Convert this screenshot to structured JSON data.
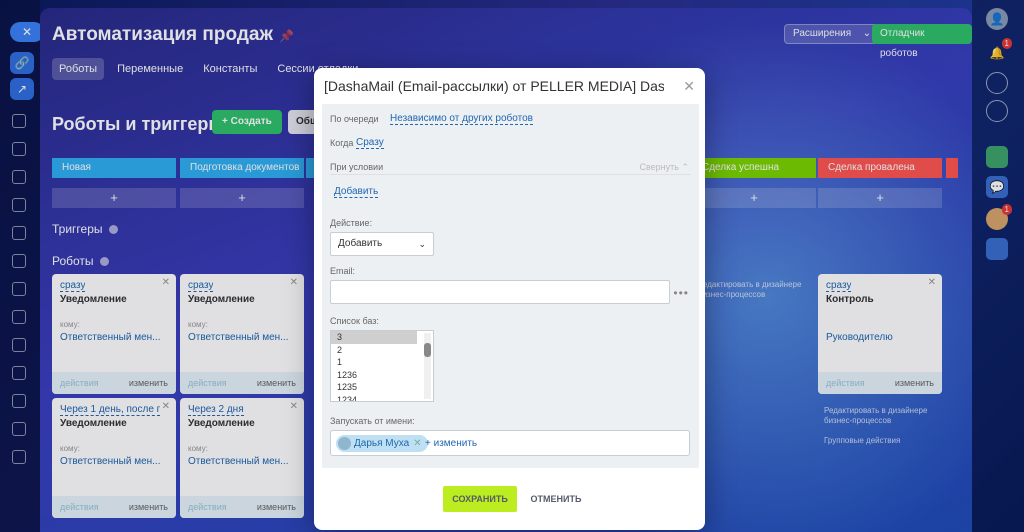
{
  "app": {
    "title": "Автоматизация продаж",
    "extensions_label": "Расширения",
    "debug_label": "Отладчик роботов",
    "tabs": [
      {
        "label": "Роботы",
        "active": true
      },
      {
        "label": "Переменные",
        "active": false
      },
      {
        "label": "Константы",
        "active": false
      },
      {
        "label": "Сессии отладки",
        "active": false
      }
    ]
  },
  "section": {
    "title": "Роботы и триггеры",
    "create_label": "Создать",
    "general_label": "Общ",
    "triggers_label": "Триггеры",
    "robots_label": "Роботы"
  },
  "stages": [
    {
      "name": "Новая",
      "color": "#2fb0f2"
    },
    {
      "name": "Подготовка документов",
      "color": "#2fb0f2"
    },
    {
      "name": "Сделка успешна",
      "color": "#7bd500"
    },
    {
      "name": "Сделка провалена",
      "color": "#ff5752"
    }
  ],
  "plus_label": "+",
  "cards": [
    {
      "time": "сразу",
      "name": "Уведомление",
      "who": "кому:",
      "target": "Ответственный мен...",
      "actions": "действия",
      "edit": "изменить"
    },
    {
      "time": "сразу",
      "name": "Уведомление",
      "who": "кому:",
      "target": "Ответственный мен...",
      "actions": "действия",
      "edit": "изменить"
    },
    {
      "time": "Через 1 день, после п...",
      "name": "Уведомление",
      "who": "кому:",
      "target": "Ответственный мен...",
      "actions": "действия",
      "edit": "изменить"
    },
    {
      "time": "Через 2 дня",
      "name": "Уведомление",
      "who": "кому:",
      "target": "Ответственный мен...",
      "actions": "действия",
      "edit": "изменить"
    },
    {
      "time": "сразу",
      "name": "Контроль",
      "who": "кому:",
      "target": "Руководителю",
      "actions": "действия",
      "edit": "изменить"
    }
  ],
  "ghost_texts": {
    "designer_edit": "Редактировать в дизайнере бизнес-процессов",
    "group_actions": "Групповые действия"
  },
  "modal": {
    "title": "[DashaMail (Email-рассылки) от PELLER MEDIA] DashaM...",
    "close_icon": "close-icon",
    "queue_label": "По очереди",
    "queue_value": "Независимо от других роботов",
    "when_label": "Когда",
    "when_value": "Сразу",
    "condition_label": "При условии",
    "collapse_label": "Свернуть",
    "add_label": "Добавить",
    "action_label": "Действие:",
    "action_value": "Добавить",
    "email_label": "Email:",
    "email_value": "",
    "lists_label": "Список баз:",
    "lists": [
      "3",
      "2",
      "1",
      "1236",
      "1235",
      "1234"
    ],
    "lists_selected": "3",
    "run_as_label": "Запускать от имени:",
    "run_as_user": "Дарья Муха",
    "run_as_change": "+ изменить",
    "save_label": "СОХРАНИТЬ",
    "cancel_label": "ОТМЕНИТЬ"
  },
  "notifications": {
    "bell_count": "1",
    "avatar_count": "1"
  }
}
